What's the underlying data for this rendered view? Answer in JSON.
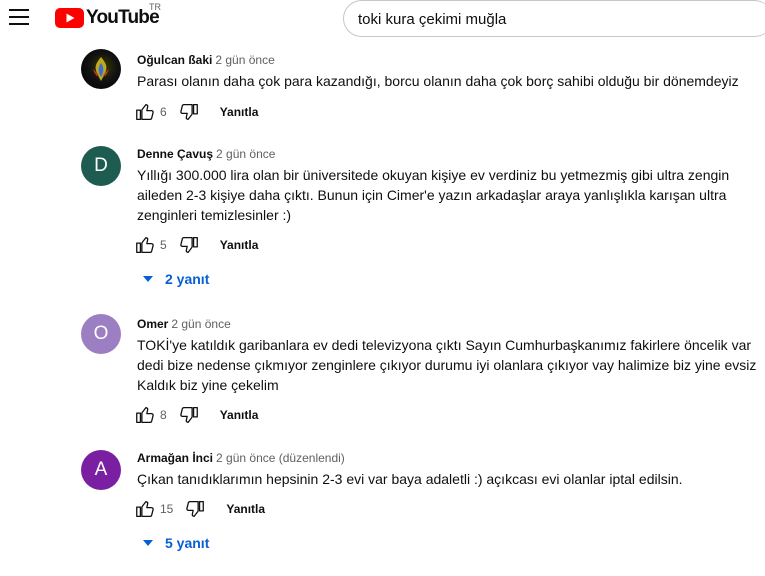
{
  "header": {
    "logo_text": "YouTube",
    "country_code": "TR",
    "search_value": "toki kura çekimi muğla",
    "brand_color": "#ff0000"
  },
  "comments": [
    {
      "author": "Oğulcan ßaki",
      "time": "2 gün önce",
      "text": "Parası olanın daha çok para kazandığı, borcu olanın daha çok borç sahibi olduğu bir dönemdeyiz",
      "likes": "6",
      "reply_label": "Yanıtla",
      "avatar_icon": "phoenix-logo-avatar"
    },
    {
      "author": "Denne Çavuş",
      "time": "2 gün önce",
      "text": "Yıllığı 300.000 lira olan bir üniversitede okuyan kişiye ev verdiniz bu yetmezmiş gibi ultra zengin aileden 2-3 kişiye daha çıktı. Bunun için Cimer'e yazın arkadaşlar araya yanlışlıkla karışan ultra zenginleri temizlesinler :)",
      "likes": "5",
      "reply_label": "Yanıtla",
      "avatar_letter": "D",
      "avatar_color": "#1e5b50",
      "replies_label": "2 yanıt"
    },
    {
      "author": "Omer",
      "time": "2 gün önce",
      "text": "TOKİ'ye katıldık garibanlara ev dedi televizyona çıktı Sayın Cumhurbaşkanımız fakirlere öncelik var dedi bize nedense çıkmıyor zenginlere çıkıyor durumu iyi olanlara çıkıyor vay halimize biz yine evsiz Kaldık biz yine çekelim",
      "likes": "8",
      "reply_label": "Yanıtla",
      "avatar_letter": "O",
      "avatar_color": "#9c7ec2"
    },
    {
      "author": "Armağan İnci",
      "time": "2 gün önce (düzenlendi)",
      "text": "Çıkan tanıdıklarımın hepsinin 2-3 evi var baya adaletli :) açıkcası evi olanlar iptal edilsin.",
      "likes": "15",
      "reply_label": "Yanıtla",
      "avatar_letter": "A",
      "avatar_color": "#7b1fa2",
      "replies_label": "5 yanıt"
    }
  ],
  "link_color": "#065fd4"
}
